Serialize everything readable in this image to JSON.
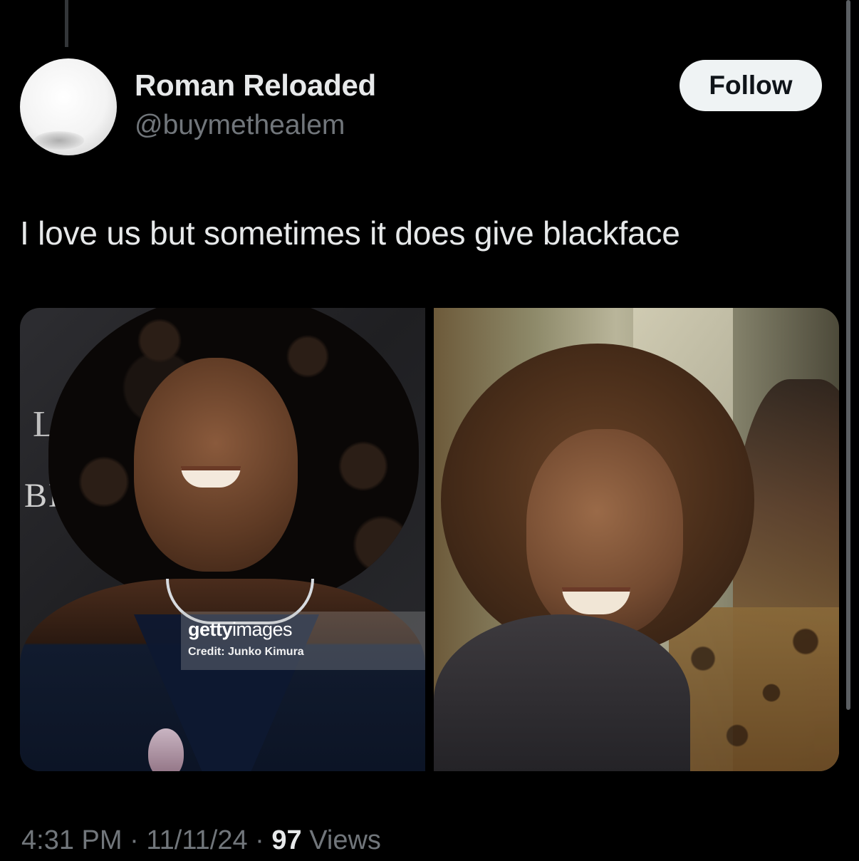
{
  "author": {
    "display_name": "Roman Reloaded",
    "handle": "@buymethealem",
    "avatar_icon": "avatar-placeholder"
  },
  "actions": {
    "follow_label": "Follow"
  },
  "tweet": {
    "text": "I love us but sometimes it does give blackface"
  },
  "media": {
    "left_photo": {
      "sign_letter": "L",
      "sign_text": "BEE",
      "watermark_brand_bold": "getty",
      "watermark_brand_light": "images",
      "watermark_credit": "Credit: Junko Kimura"
    },
    "right_photo": {}
  },
  "meta": {
    "time": "4:31 PM",
    "separator": "·",
    "date": "11/11/24",
    "views_count": "97",
    "views_label": "Views"
  },
  "colors": {
    "background": "#000000",
    "primary_text": "#e7e9ea",
    "secondary_text": "#71767b",
    "follow_button_bg": "#eff3f4",
    "follow_button_text": "#0f1419"
  }
}
